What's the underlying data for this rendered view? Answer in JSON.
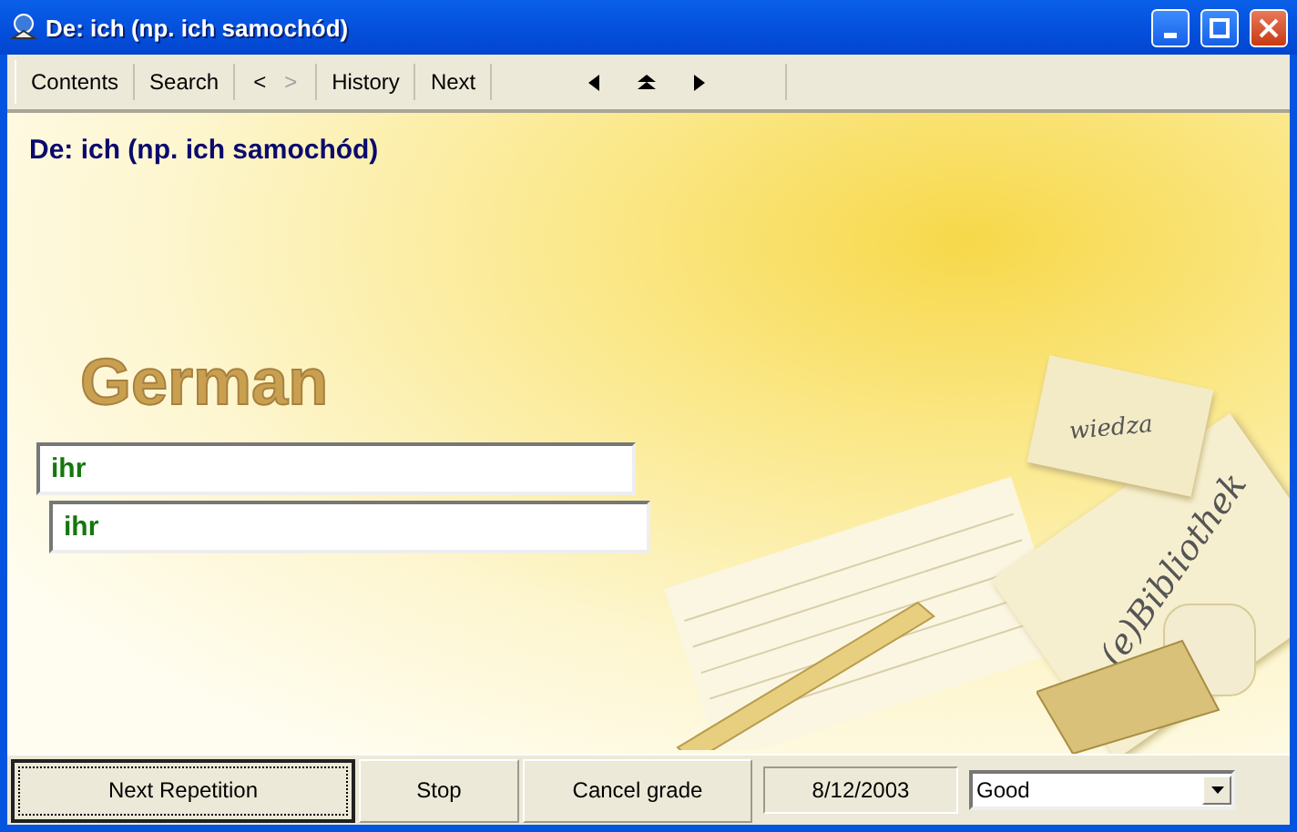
{
  "window": {
    "title": "De: ich (np. ich samochód)"
  },
  "toolbar": {
    "items": [
      {
        "kind": "button",
        "label": "Contents",
        "disabled": false
      },
      {
        "kind": "button",
        "label": "Search",
        "disabled": false
      },
      {
        "kind": "pair",
        "label": "<",
        "disabled": false,
        "second": ">",
        "second_disabled": true
      },
      {
        "kind": "button",
        "label": "History",
        "disabled": false
      },
      {
        "kind": "button",
        "label": "Next",
        "disabled": false
      }
    ]
  },
  "question": "De: ich (np. ich samochód)",
  "answers": [
    {
      "value": "ihr"
    },
    {
      "value": "ihr"
    }
  ],
  "artwork": {
    "title": "German",
    "card_text": "wiedza",
    "book_text": "(e)Bibliothek"
  },
  "bottom_bar": {
    "buttons": [
      {
        "label": "Next Repetition",
        "focused": true
      },
      {
        "label": "Stop",
        "focused": false
      },
      {
        "label": "Cancel grade",
        "focused": false
      }
    ],
    "date": "8/12/2003",
    "grade": "Good"
  }
}
